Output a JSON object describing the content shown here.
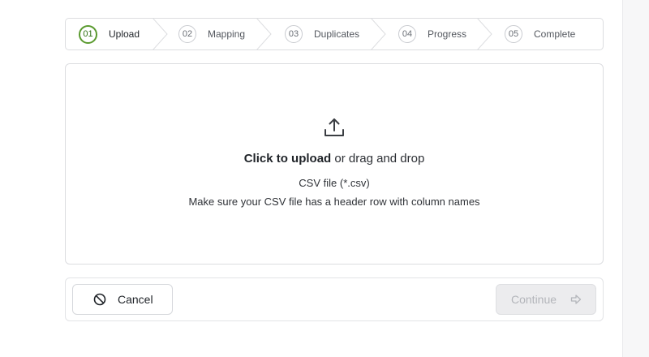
{
  "stepper": {
    "steps": [
      {
        "number": "01",
        "label": "Upload",
        "active": true
      },
      {
        "number": "02",
        "label": "Mapping",
        "active": false
      },
      {
        "number": "03",
        "label": "Duplicates",
        "active": false
      },
      {
        "number": "04",
        "label": "Progress",
        "active": false
      },
      {
        "number": "05",
        "label": "Complete",
        "active": false
      }
    ]
  },
  "dropzone": {
    "icon": "upload-icon",
    "action_text": "Click to upload",
    "action_suffix": " or drag and drop",
    "file_type": "CSV file (*.csv)",
    "hint": "Make sure your CSV file has a header row with column names"
  },
  "footer": {
    "cancel_label": "Cancel",
    "cancel_icon": "ban-icon",
    "continue_label": "Continue",
    "continue_icon": "arrow-right-icon",
    "continue_disabled": true
  },
  "colors": {
    "active_step": "#5a9a2f",
    "border": "#dcdde0",
    "disabled_bg": "#ececee"
  }
}
